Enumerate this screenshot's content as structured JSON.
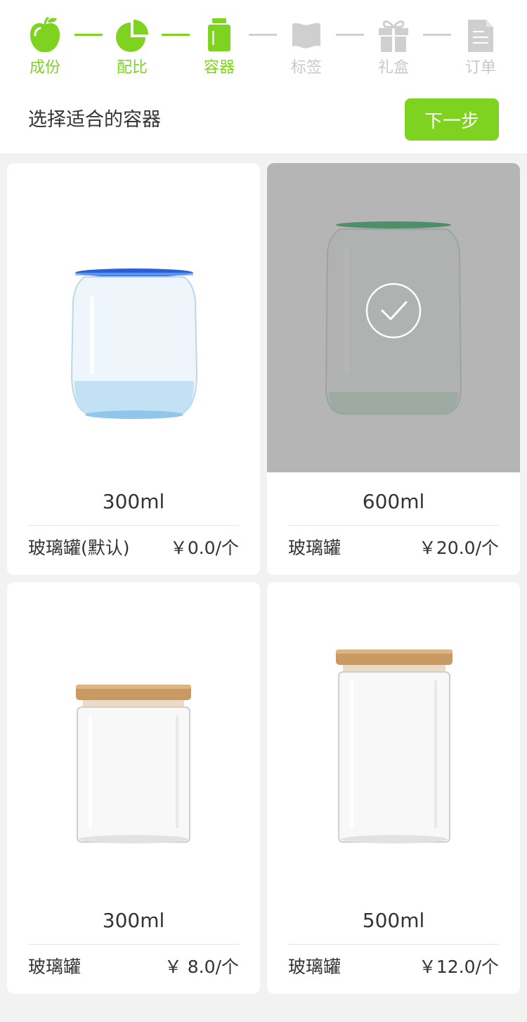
{
  "steps": [
    {
      "label": "成份",
      "icon": "apple-icon",
      "state": "done"
    },
    {
      "label": "配比",
      "icon": "pie-chart-icon",
      "state": "done"
    },
    {
      "label": "容器",
      "icon": "jar-icon",
      "state": "current"
    },
    {
      "label": "标签",
      "icon": "flag-icon",
      "state": "todo"
    },
    {
      "label": "礼盒",
      "icon": "gift-icon",
      "state": "todo"
    },
    {
      "label": "订单",
      "icon": "document-icon",
      "state": "todo"
    }
  ],
  "header": {
    "subtitle": "选择适合的容器",
    "next_label": "下一步"
  },
  "colors": {
    "accent": "#7ed321",
    "inactive": "#c8c8c8"
  },
  "containers": [
    {
      "size": "300ml",
      "name": "玻璃罐(默认)",
      "price": "￥0.0/个",
      "selected": false,
      "style": "blue-rim-jar"
    },
    {
      "size": "600ml",
      "name": "玻璃罐",
      "price": "￥20.0/个",
      "selected": true,
      "style": "green-rim-jar"
    },
    {
      "size": "300ml",
      "name": "玻璃罐",
      "price": "￥  8.0/个",
      "selected": false,
      "style": "wood-lid-jar-short"
    },
    {
      "size": "500ml",
      "name": "玻璃罐",
      "price": "￥12.0/个",
      "selected": false,
      "style": "wood-lid-jar-tall"
    }
  ]
}
